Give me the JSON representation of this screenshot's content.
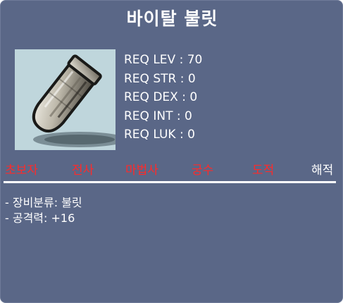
{
  "item": {
    "name": "바이탈 불릿",
    "icon": "bullet-icon"
  },
  "requirements": [
    "REQ LEV : 70",
    "REQ STR : 0",
    "REQ DEX : 0",
    "REQ INT : 0",
    "REQ LUK : 0"
  ],
  "jobs": [
    {
      "label": "초보자",
      "status": "unavailable"
    },
    {
      "label": "전사",
      "status": "unavailable"
    },
    {
      "label": "마법사",
      "status": "unavailable"
    },
    {
      "label": "궁수",
      "status": "unavailable"
    },
    {
      "label": "도적",
      "status": "unavailable"
    },
    {
      "label": "해적",
      "status": "available"
    }
  ],
  "colors": {
    "background": "#5a6787",
    "unavailable": "#ff2a2a",
    "available": "#ffffff"
  },
  "description": [
    "- 장비분류: 불릿",
    "- 공격력: +16"
  ]
}
